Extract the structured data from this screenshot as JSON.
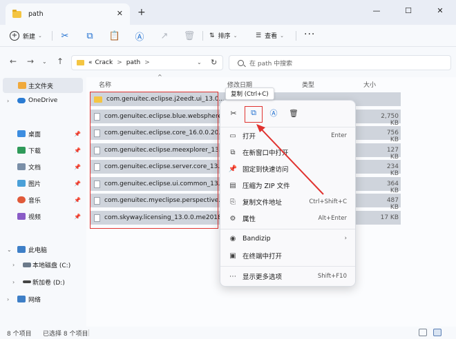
{
  "window": {
    "tab_title": "path",
    "tab_close": "✕",
    "new_tab": "+",
    "minimize": "—",
    "maximize": "☐",
    "close": "✕"
  },
  "toolbar": {
    "new_label": "新建",
    "sort_label": "排序",
    "view_label": "查看",
    "more_label": "···",
    "icons": [
      "cut-icon",
      "copy-icon",
      "paste-icon",
      "rename-icon",
      "share-icon",
      "delete-icon"
    ]
  },
  "address": {
    "prefix": "«",
    "crumbs": [
      "Crack",
      "path"
    ],
    "separator": ">",
    "search_placeholder": "在 path 中搜索"
  },
  "sidebar": {
    "items": [
      {
        "label": "主文件夹",
        "pinned": false,
        "selected": true
      },
      {
        "label": "OneDrive",
        "pinned": false
      },
      {
        "label": "桌面",
        "pinned": true
      },
      {
        "label": "下载",
        "pinned": true
      },
      {
        "label": "文档",
        "pinned": true
      },
      {
        "label": "图片",
        "pinned": true
      },
      {
        "label": "音乐",
        "pinned": true
      },
      {
        "label": "视频",
        "pinned": true
      },
      {
        "label": "此电脑",
        "pinned": false
      },
      {
        "label": "本地磁盘 (C:)",
        "pinned": false
      },
      {
        "label": "新加卷 (D:)",
        "pinned": false
      },
      {
        "label": "网络",
        "pinned": false
      }
    ]
  },
  "columns": {
    "name": "名称",
    "modified": "修改日期",
    "type": "类型",
    "size": "大小"
  },
  "files": [
    {
      "name": "com.genuitec.eclipse.j2eedt.ui_13.0...",
      "kind": "folder",
      "size": ""
    },
    {
      "name": "com.genuitec.eclipse.blue.websphere...",
      "kind": "file",
      "size": "2,750 KB"
    },
    {
      "name": "com.genuitec.eclipse.core_16.0.0.20...",
      "kind": "file",
      "size": "756 KB"
    },
    {
      "name": "com.genuitec.eclipse.meexplorer_13...",
      "kind": "file",
      "size": "127 KB"
    },
    {
      "name": "com.genuitec.eclipse.server.core_13...",
      "kind": "file",
      "size": "234 KB"
    },
    {
      "name": "com.genuitec.eclipse.ui.common_13...",
      "kind": "file",
      "size": "364 KB"
    },
    {
      "name": "com.genuitec.myeclipse.perspective...",
      "kind": "file",
      "size": "487 KB"
    },
    {
      "name": "com.skyway.licensing_13.0.0.me2018...",
      "kind": "file",
      "size": "17 KB"
    }
  ],
  "tooltip": "复制 (Ctrl+C)",
  "context_menu": {
    "top_icons": [
      "cut-icon",
      "copy-icon",
      "rename-icon",
      "delete-icon"
    ],
    "items": [
      {
        "label": "打开",
        "shortcut": "Enter",
        "icon": "folder-icon"
      },
      {
        "label": "在新窗口中打开",
        "shortcut": "",
        "icon": "new-window-icon"
      },
      {
        "label": "固定到快速访问",
        "shortcut": "",
        "icon": "pin-icon"
      },
      {
        "label": "压缩为 ZIP 文件",
        "shortcut": "",
        "icon": "zip-icon"
      },
      {
        "label": "复制文件地址",
        "shortcut": "Ctrl+Shift+C",
        "icon": "copy-path-icon"
      },
      {
        "label": "属性",
        "shortcut": "Alt+Enter",
        "icon": "properties-icon"
      },
      {
        "label": "Bandizip",
        "shortcut": "›",
        "icon": "bandizip-icon"
      },
      {
        "label": "在终端中打开",
        "shortcut": "",
        "icon": "terminal-icon"
      },
      {
        "label": "显示更多选项",
        "shortcut": "Shift+F10",
        "icon": "more-options-icon"
      }
    ]
  },
  "status": {
    "item_count": "8 个项目",
    "selected_count": "已选择 8 个项目"
  },
  "colors": {
    "accent": "#1f6fd0",
    "annotation_red": "#e0322f",
    "selection": "#cfd4dc"
  }
}
